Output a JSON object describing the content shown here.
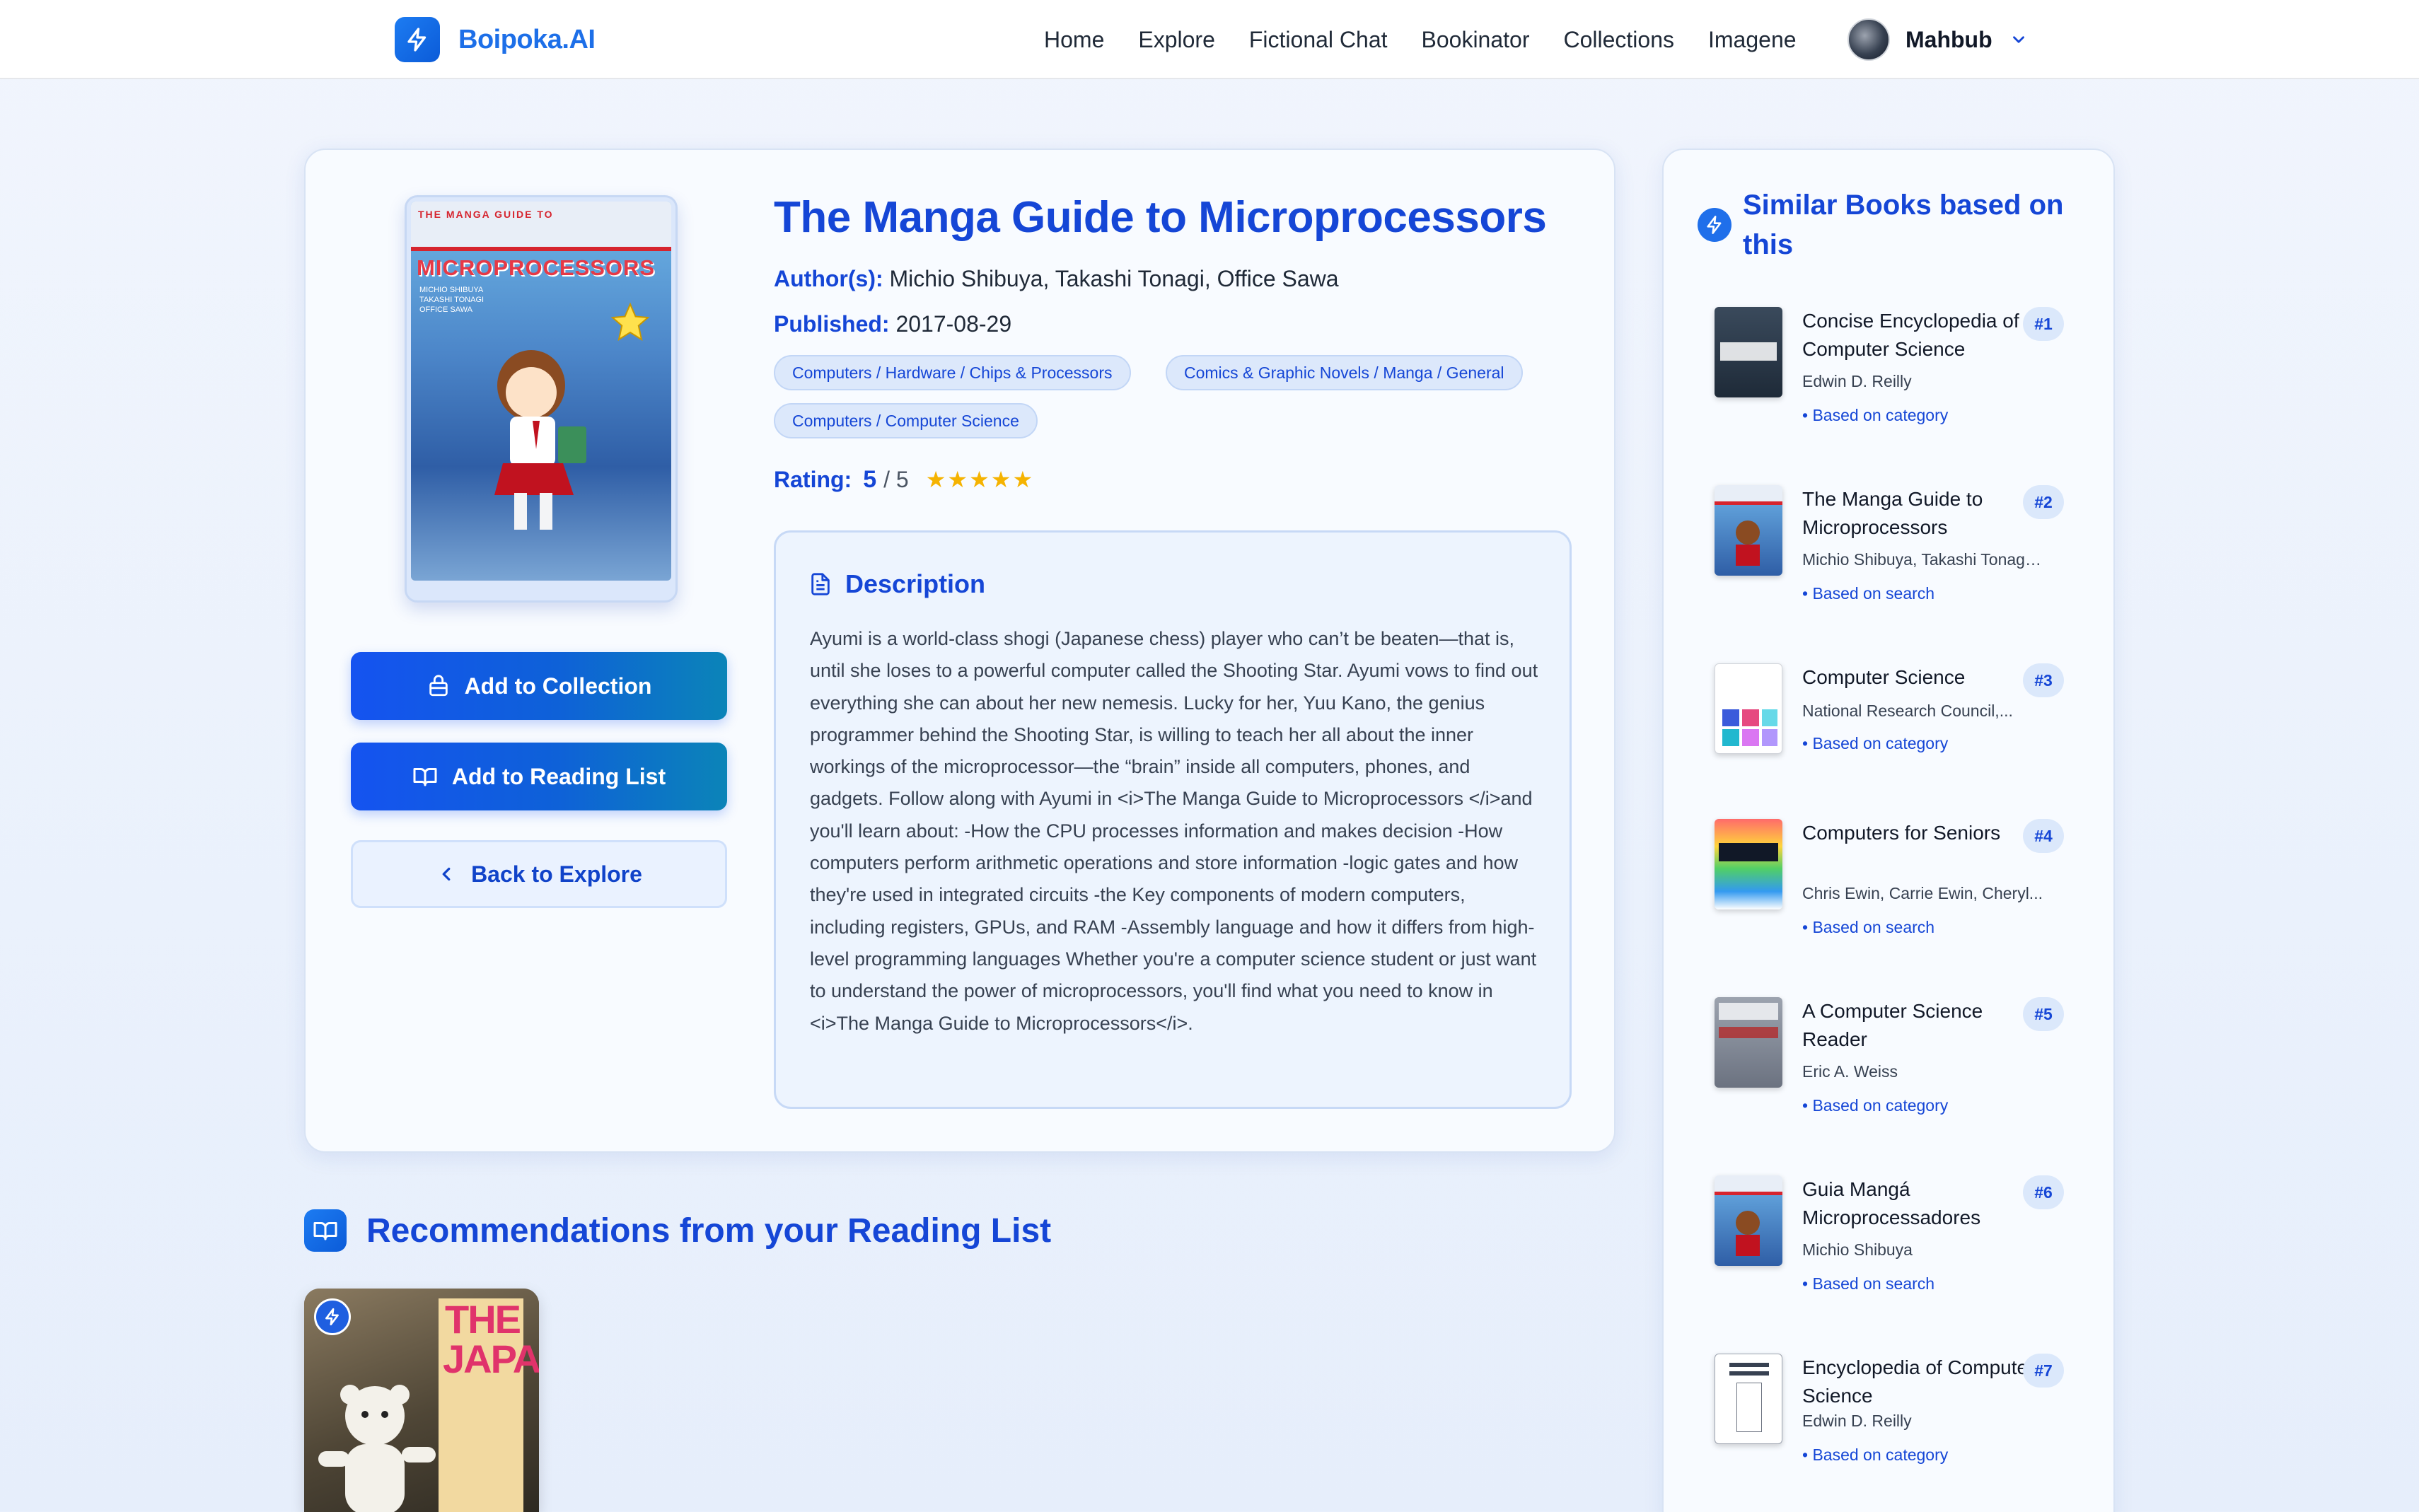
{
  "app": {
    "name": "Boipoka.AI"
  },
  "nav": {
    "links": [
      "Home",
      "Explore",
      "Fictional Chat",
      "Bookinator",
      "Collections",
      "Imagene"
    ],
    "user": "Mahbub"
  },
  "book": {
    "title": "The Manga Guide to Microprocessors",
    "authors_label": "Author(s):",
    "authors": "Michio Shibuya, Takashi Tonagi, Office Sawa",
    "published_label": "Published:",
    "published": "2017-08-29",
    "categories": [
      "Computers / Hardware / Chips & Processors",
      "Comics & Graphic Novels / Manga / General",
      "Computers / Computer Science"
    ],
    "rating_label": "Rating:",
    "rating": "5",
    "rating_max": "/ 5",
    "stars": 5,
    "cover": {
      "series": "THE MANGA GUIDE TO",
      "title": "MICROPROCESSORS",
      "authors": "MICHIO SHIBUYA TAKASHI TONAGI OFFICE SAWA"
    }
  },
  "actions": {
    "add_collection": "Add to Collection",
    "add_reading_list": "Add to Reading List",
    "back": "Back to Explore"
  },
  "description": {
    "heading": "Description",
    "text": "Ayumi is a world-class shogi (Japanese chess) player who can’t be beaten—that is, until she loses to a powerful computer called the Shooting Star. Ayumi vows to find out everything she can about her new nemesis. Lucky for her, Yuu Kano, the genius programmer behind the Shooting Star, is willing to teach her all about the inner workings of the microprocessor—the “brain” inside all computers, phones, and gadgets.  Follow along with Ayumi in <i>The Manga Guide to Microprocessors </i>and you'll learn about: -How the CPU processes information and makes decision -How computers perform arithmetic operations and store information -logic gates and how they're used in integrated circuits -the Key components of modern computers, including registers, GPUs, and RAM -Assembly language and how it differs from high-level programming languages Whether you're a computer science student or just want to understand the power of microprocessors, you'll find what you need to know in <i>The Manga Guide to Microprocessors</i>."
  },
  "recommendations": {
    "heading": "Recommendations from your Reading List",
    "items": [
      {
        "cover_text": "THE JAPANESE"
      }
    ]
  },
  "similar": {
    "heading": "Similar Books based on this",
    "items": [
      {
        "title": "Concise Encyclopedia of Computer Science",
        "author": "Edwin D. Reilly",
        "reason": "• Based on category",
        "rank": "#1"
      },
      {
        "title": "The Manga Guide to Microprocessors",
        "author": "Michio Shibuya, Takashi Tonagi,...",
        "reason": "• Based on search",
        "rank": "#2"
      },
      {
        "title": "Computer Science",
        "author": "National Research Council,...",
        "reason": "• Based on category",
        "rank": "#3"
      },
      {
        "title": "Computers for Seniors",
        "author": "Chris Ewin, Carrie Ewin, Cheryl...",
        "reason": "• Based on search",
        "rank": "#4"
      },
      {
        "title": "A Computer Science Reader",
        "author": "Eric A. Weiss",
        "reason": "• Based on category",
        "rank": "#5"
      },
      {
        "title": "Guia Mangá Microprocessadores",
        "author": "Michio Shibuya",
        "reason": "• Based on search",
        "rank": "#6"
      },
      {
        "title": "Encyclopedia of Computer Science",
        "author": "Edwin D. Reilly",
        "reason": "• Based on category",
        "rank": "#7"
      }
    ]
  },
  "colors": {
    "brand": "#1d6fe8",
    "heading": "#1546d6",
    "star": "#f5b301"
  }
}
